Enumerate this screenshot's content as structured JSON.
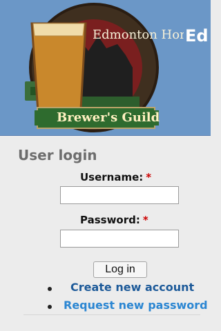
{
  "header": {
    "logo": {
      "top_text": "Edmonton Home",
      "bottom_text": "Brewer's Guild",
      "icon": "beer-glass-icon"
    },
    "site_name_visible": "Ed"
  },
  "login_block": {
    "title": "User login",
    "username": {
      "label": "Username:",
      "required_marker": "*",
      "value": ""
    },
    "password": {
      "label": "Password:",
      "required_marker": "*",
      "value": ""
    },
    "login_button": "Log in",
    "links": [
      {
        "label": "Create new account"
      },
      {
        "label": "Request new password"
      }
    ]
  },
  "colors": {
    "header_bg": "#6b97c7",
    "link_primary": "#1d5a99",
    "link_secondary": "#2b86d2",
    "required": "#cc0000"
  }
}
